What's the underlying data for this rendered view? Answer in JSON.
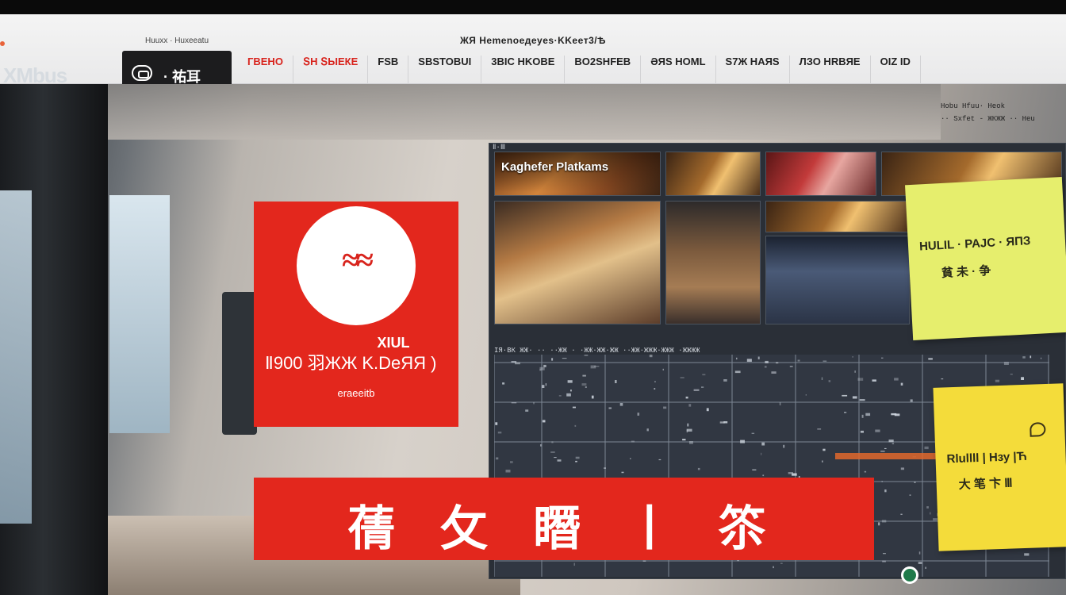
{
  "app": {
    "title": "ЖЯ Hеmеnоeдeyeѕ·KKeeт3/Ѣ",
    "logo_text": "XMbus"
  },
  "toolbar": {
    "caption": "Huuxx · Huxeeatu",
    "label": "· 祐耳"
  },
  "tabs": [
    {
      "label": "ГВЕНО",
      "active": true
    },
    {
      "label": "ՏΗ ՏЫЕКЕ",
      "active": true
    },
    {
      "label": "FSB"
    },
    {
      "label": "SBSTOBUI"
    },
    {
      "label": "3BIC HKOBE"
    },
    {
      "label": "BO2SHFEB"
    },
    {
      "label": "ƏЯS HOML"
    },
    {
      "label": "S7Ж HAЯS"
    },
    {
      "label": "ЛЗО HRBЯE"
    },
    {
      "label": "OIZ ID"
    }
  ],
  "status": {
    "lines": [
      "Hobu Hfuu· Heok",
      "·· Sxfet - ЖКЖЖ ·· Heu"
    ]
  },
  "red_card": {
    "line1": "XIUL",
    "line2": "Ⅱ900   羽ЖЖ K.DeЯЯ )",
    "line3": "eraeeitb"
  },
  "dashboard": {
    "title": "Ⅱ·Ⅲ",
    "tiles": [
      {
        "label": "Kaghefer Platkams",
        "theme": "food"
      },
      {
        "label": "",
        "theme": "market"
      },
      {
        "label": "",
        "theme": "shelf"
      },
      {
        "label": "",
        "theme": "meat"
      },
      {
        "label": "",
        "theme": "warm"
      },
      {
        "label": "",
        "theme": "night"
      },
      {
        "label": "",
        "theme": "warm"
      },
      {
        "label": "",
        "theme": "night"
      }
    ],
    "chart_header": "ӀЯ·ВК ЖЖ· ·· ··ЖЖ  ·   ·ЖЖ·ЖЖ·ЖЖ  ··ЖЖ·ЖЖЖ·ЖЖЖ ·ЖЖЖЖ"
  },
  "notes": [
    {
      "lines": [
        "HULIL · PAJC · ЯПЗ",
        "貧  未 · 争"
      ]
    },
    {
      "lines": [
        "Rlullll | Hзу |Ћ",
        "大   笔   卞  Ⅲ"
      ]
    }
  ],
  "banner": {
    "text": "蒨 攵 䁮 丨 䇣"
  },
  "colors": {
    "accent_red": "#e3271d",
    "note_green": "#e6ee6d",
    "note_yellow": "#f4dc3a",
    "dash_bg": "#2a2f37"
  },
  "icons": [
    "camera-icon",
    "pin-icon"
  ]
}
